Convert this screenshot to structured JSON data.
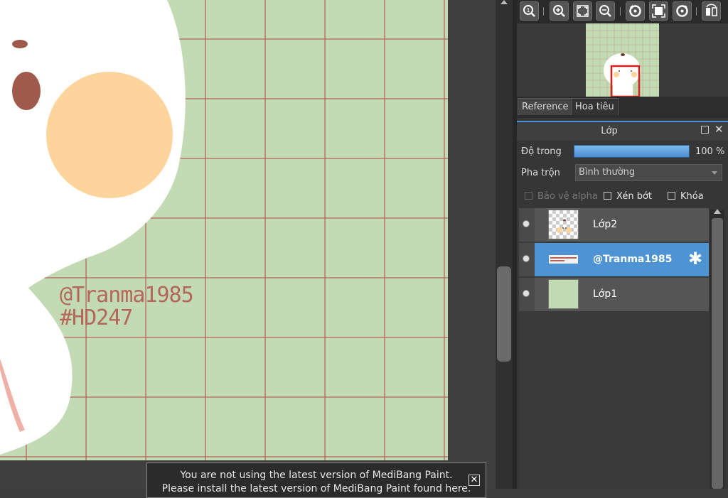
{
  "canvas": {
    "watermark_line1": "@Tranma1985",
    "watermark_line2": "#HD247",
    "colors": {
      "background": "#c3dbb4",
      "grid": "#b5655a",
      "character": "#ffffff",
      "cheek": "#fdd59c",
      "eye": "#a05a4b"
    }
  },
  "notice": {
    "line1": "You are not using the latest version of MediBang Paint.",
    "line2": "Please install the latest version of MediBang Paint found here.",
    "close_glyph": "✕"
  },
  "toolbar": {
    "icons": [
      "actual-size-icon",
      "zoom-in-icon",
      "fit-icon",
      "zoom-out-icon",
      "rotate-left-icon",
      "reset-rotation-icon",
      "rotate-right-icon",
      "flip-icon"
    ]
  },
  "tabs": [
    {
      "label": "Reference",
      "active": true
    },
    {
      "label": "Hoa tiêu",
      "active": false
    }
  ],
  "layer_panel": {
    "title": "Lớp",
    "opacity_label": "Độ trong",
    "opacity_value": "100 %",
    "opacity_fraction": 1.0,
    "blend_label": "Pha trộn",
    "blend_value": "Bình thường",
    "protect_alpha_label": "Bảo vệ alpha",
    "clipping_label": "Xén bớt",
    "lock_label": "Khóa",
    "layers": [
      {
        "name": "Lớp2",
        "selected": false
      },
      {
        "name": "@Tranma1985",
        "selected": true
      },
      {
        "name": "Lớp1",
        "selected": false
      }
    ],
    "accent_color": "#4e93d3"
  }
}
